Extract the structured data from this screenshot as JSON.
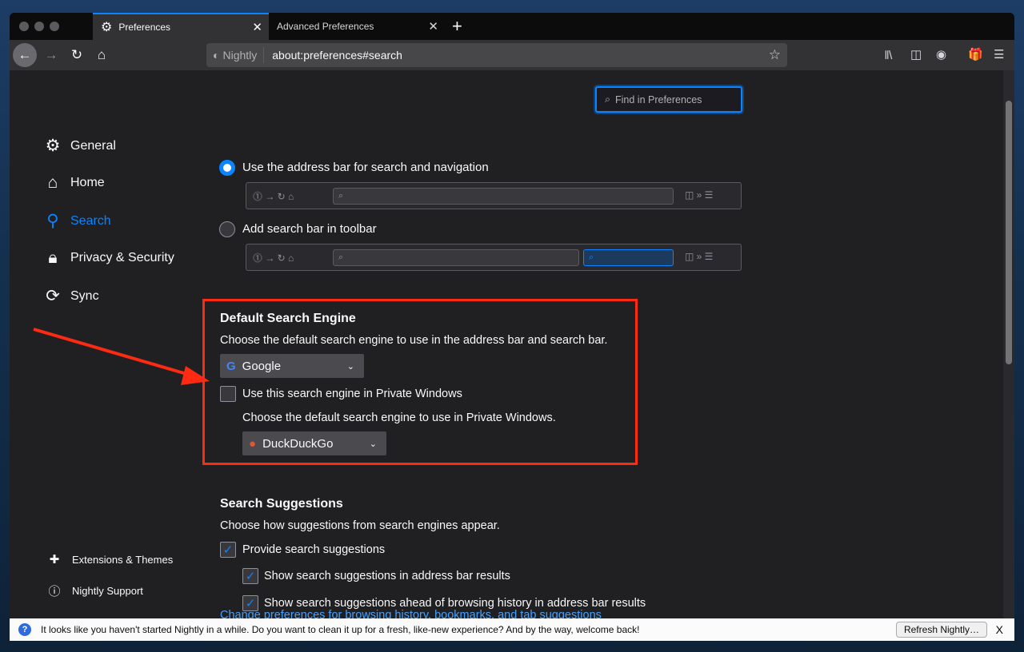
{
  "tabs": [
    {
      "label": "Preferences"
    },
    {
      "label": "Advanced Preferences"
    }
  ],
  "urlbar": {
    "identity": "Nightly",
    "url": "about:preferences#search"
  },
  "find": {
    "placeholder": "Find in Preferences"
  },
  "sidebar": {
    "items": [
      {
        "label": "General"
      },
      {
        "label": "Home"
      },
      {
        "label": "Search"
      },
      {
        "label": "Privacy & Security"
      },
      {
        "label": "Sync"
      }
    ],
    "footer": [
      {
        "label": "Extensions & Themes"
      },
      {
        "label": "Nightly Support"
      }
    ]
  },
  "toolbar_option": {
    "address_bar": "Use the address bar for search and navigation",
    "search_bar": "Add search bar in toolbar"
  },
  "default_engine": {
    "title": "Default Search Engine",
    "desc": "Choose the default search engine to use in the address bar and search bar.",
    "engine": "Google",
    "private_checkbox": "Use this search engine in Private Windows",
    "private_desc": "Choose the default search engine to use in Private Windows.",
    "private_engine": "DuckDuckGo"
  },
  "suggestions": {
    "title": "Search Suggestions",
    "desc": "Choose how suggestions from search engines appear.",
    "provide": "Provide search suggestions",
    "address_bar": "Show search suggestions in address bar results",
    "ahead": "Show search suggestions ahead of browsing history in address bar results",
    "link": "Change preferences for browsing history, bookmarks, and tab suggestions"
  },
  "notification": {
    "message": "It looks like you haven't started Nightly in a while. Do you want to clean it up for a fresh, like-new experience? And by the way, welcome back!",
    "button": "Refresh Nightly…",
    "close": "X"
  },
  "colors": {
    "accent": "#0a84ff",
    "annotation": "#ff2a12"
  }
}
